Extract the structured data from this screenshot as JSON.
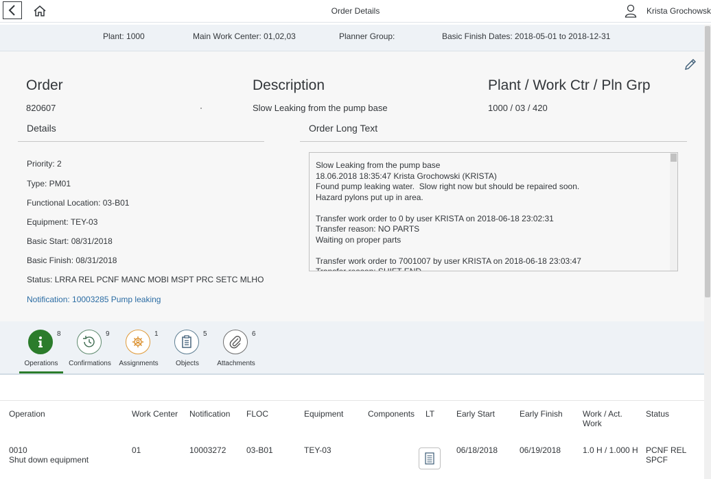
{
  "shell": {
    "title": "Order Details",
    "user_name": "Krista Grochowski"
  },
  "filter_bar": {
    "plant": "Plant: 1000",
    "main_work_center": "Main Work Center: 01,02,03",
    "planner_group": "Planner Group:",
    "basic_finish_dates": "Basic Finish Dates: 2018-05-01 to 2018-12-31"
  },
  "header": {
    "order_title": "Order",
    "order_value": "820607",
    "description_title": "Description",
    "description_value": "Slow Leaking from the pump base",
    "plant_title": "Plant / Work Ctr / Pln Grp",
    "plant_value": "1000 / 03 / 420"
  },
  "details": {
    "title": "Details",
    "priority": "Priority: 2",
    "type": "Type: PM01",
    "functional_location": "Functional Location: 03-B01",
    "equipment": "Equipment: TEY-03",
    "basic_start": "Basic Start: 08/31/2018",
    "basic_finish": "Basic Finish: 08/31/2018",
    "status": "Status: LRRA REL PCNF MANC MOBI MSPT PRC SETC MLHO",
    "notification_link": "Notification: 10003285 Pump leaking"
  },
  "long_text": {
    "title": "Order Long Text",
    "content": "Slow Leaking from the pump base\n18.06.2018 18:35:47 Krista Grochowski (KRISTA)\nFound pump leaking water.  Slow right now but should be repaired soon.\nHazard pylons put up in area.\n\nTransfer work order to 0 by user KRISTA on 2018-06-18 23:02:31\nTransfer reason: NO PARTS\nWaiting on proper parts\n\nTransfer work order to 7001007 by user KRISTA on 2018-06-18 23:03:47\nTransfer reason: SHIFT END"
  },
  "tabs": [
    {
      "label": "Operations",
      "count": "8",
      "icon": "info-icon",
      "active": true
    },
    {
      "label": "Confirmations",
      "count": "9",
      "icon": "clock-history-icon",
      "active": false
    },
    {
      "label": "Assignments",
      "count": "1",
      "icon": "assignment-icon",
      "active": false
    },
    {
      "label": "Objects",
      "count": "5",
      "icon": "clipboard-icon",
      "active": false
    },
    {
      "label": "Attachments",
      "count": "6",
      "icon": "paperclip-icon",
      "active": false
    }
  ],
  "table": {
    "columns": [
      "Operation",
      "Work Center",
      "Notification",
      "FLOC",
      "Equipment",
      "Components",
      "LT",
      "Early Start",
      "Early Finish",
      "Work / Act. Work",
      "Status"
    ],
    "rows": [
      {
        "operation": "0010",
        "operation_desc": "Shut down equipment",
        "work_center": "01",
        "notification": "10003272",
        "floc": "03-B01",
        "equipment": "TEY-03",
        "components": "",
        "early_start": "06/18/2018",
        "early_finish": "06/19/2018",
        "work": "1.0 H / 1.000 H",
        "status": "PCNF REL SPCF"
      }
    ]
  },
  "colors": {
    "accent_green": "#2b7c2b",
    "link_blue": "#2b6ca3",
    "assignment_orange": "#e09a38",
    "icon_blue_gray": "#5d7e92"
  }
}
